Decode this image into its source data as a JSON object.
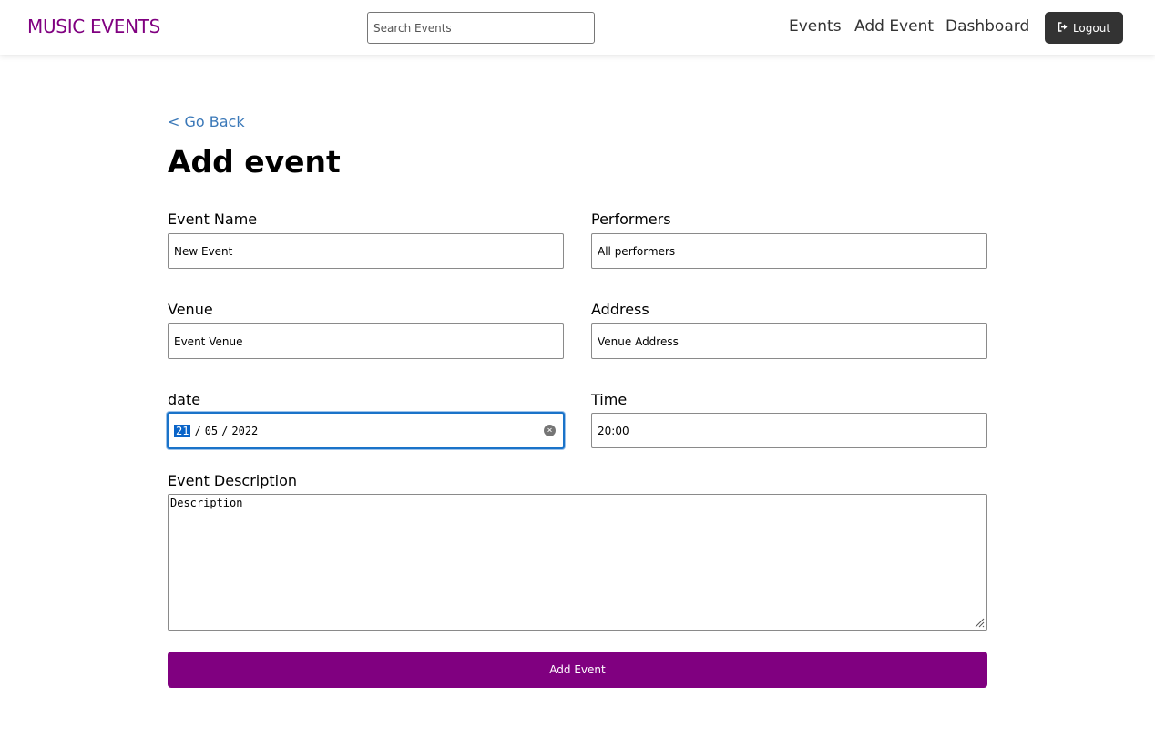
{
  "header": {
    "logo": "MUSIC EVENTS",
    "search_placeholder": "Search Events",
    "nav": {
      "events": "Events",
      "add_event": "Add Event",
      "dashboard": "Dashboard"
    },
    "logout_label": "Logout",
    "logout_icon": "sign-out-icon"
  },
  "page": {
    "back_link": "< Go Back",
    "title": "Add event"
  },
  "form": {
    "event_name": {
      "label": "Event Name",
      "value": "New Event"
    },
    "performers": {
      "label": "Performers",
      "value": "All performers"
    },
    "venue": {
      "label": "Venue",
      "value": "Event Venue"
    },
    "address": {
      "label": "Address",
      "value": "Venue Address"
    },
    "date": {
      "label": "date",
      "day": "21",
      "month": "05",
      "year": "2022",
      "separator": "/"
    },
    "time": {
      "label": "Time",
      "value": "20:00"
    },
    "description": {
      "label": "Event Description",
      "value": "Description"
    },
    "submit_label": "Add Event"
  },
  "colors": {
    "brand": "#800080",
    "link": "#3a78b8",
    "logout_bg": "#333333",
    "focus": "#1a73c9"
  }
}
